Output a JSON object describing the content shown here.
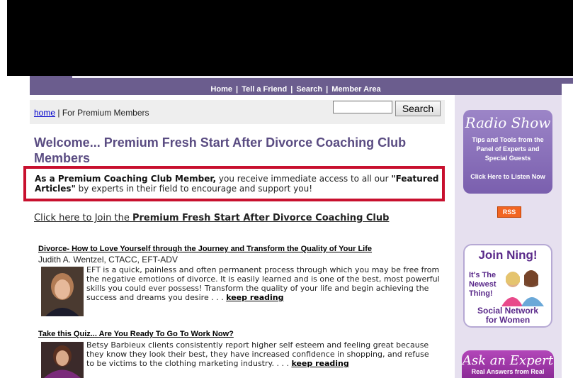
{
  "nav": {
    "items": [
      "Home",
      "Tell a Friend",
      "Search",
      "Member Area"
    ],
    "separator": "|"
  },
  "breadcrumb": {
    "home_link": "home",
    "separator": "|",
    "current": "For Premium Members"
  },
  "search": {
    "value": "",
    "button_label": "Search"
  },
  "page_title": "Welcome... Premium Fresh Start After Divorce Coaching Club Members",
  "notice": {
    "lead_bold": "As a Premium Coaching Club Member,",
    "middle": " you receive immediate access to all our ",
    "featured_bold": "\"Featured Articles\"",
    "tail": " by experts in their field to encourage and support you!"
  },
  "join": {
    "prefix": "Click here to Join the ",
    "bold": "Premium Fresh Start After Divorce Coaching Club"
  },
  "articles": [
    {
      "title": "Divorce- How to Love Yourself through the Journey and Transform the Quality of Your Life",
      "author": "Judith A. Wentzel, CTACC, EFT-ADV",
      "excerpt": "EFT is a quick, painless and often permanent process through which you may be free from the negative emotions of divorce. It is easily learned and is one of the best, most powerful skills you could ever possess! Transform the quality of your life and begin achieving the success and dreams you desire . . . ",
      "link": "keep reading"
    },
    {
      "title": "Take this Quiz... Are You Ready To Go To Work Now?",
      "author": "",
      "excerpt": "Betsy Barbieux clients consistently report higher self esteem and feeling great because they know they look their best, they have increased confidence in shopping, and refuse to be victims to the clothing marketing industry. . . . ",
      "link": "keep reading"
    }
  ],
  "sidebar": {
    "radio": {
      "title": "Radio Show",
      "desc": "Tips and Tools from the Panel of Experts and Special Guests",
      "cta": "Click Here to Listen Now"
    },
    "rss_label": "RSS",
    "ning": {
      "title": "Join Ning!",
      "sub1": "It's The",
      "sub2": "Newest",
      "sub3": "Thing!",
      "footer1": "Social Network",
      "footer2": "for Women"
    },
    "expert": {
      "title": "Ask an Expert",
      "sub": "Real Answers from Real"
    }
  },
  "colors": {
    "nav_bg": "#6b5d8e",
    "title": "#5a4c82",
    "notice_border": "#c8102e",
    "sidebar_bg": "#e6e0ef"
  }
}
